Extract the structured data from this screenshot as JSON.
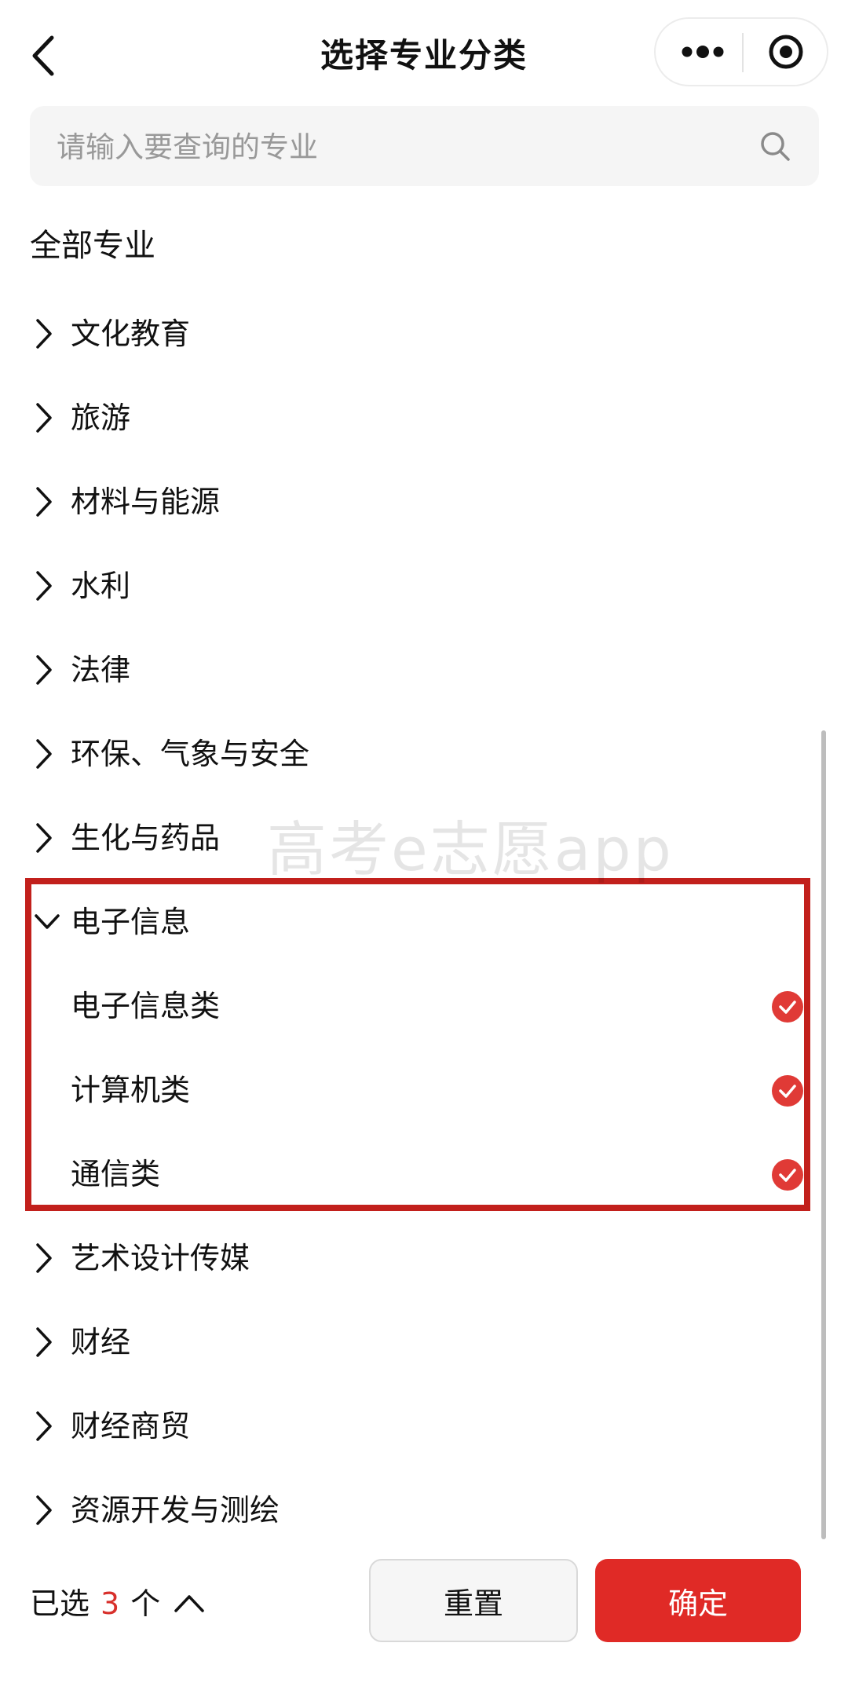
{
  "header": {
    "title": "选择专业分类",
    "icons": {
      "back": "back-arrow-icon",
      "more": "more-dots-icon",
      "close": "target-circle-icon"
    }
  },
  "search": {
    "placeholder": "请输入要查询的专业",
    "value": "",
    "icon": "search-icon"
  },
  "section_title": "全部专业",
  "categories": [
    {
      "label": "文化教育",
      "expanded": false
    },
    {
      "label": "旅游",
      "expanded": false
    },
    {
      "label": "材料与能源",
      "expanded": false
    },
    {
      "label": "水利",
      "expanded": false
    },
    {
      "label": "法律",
      "expanded": false
    },
    {
      "label": "环保、气象与安全",
      "expanded": false
    },
    {
      "label": "生化与药品",
      "expanded": false
    },
    {
      "label": "电子信息",
      "expanded": true,
      "children": [
        {
          "label": "电子信息类",
          "selected": true
        },
        {
          "label": "计算机类",
          "selected": true
        },
        {
          "label": "通信类",
          "selected": true
        }
      ]
    },
    {
      "label": "艺术设计传媒",
      "expanded": false
    },
    {
      "label": "财经",
      "expanded": false
    },
    {
      "label": "财经商贸",
      "expanded": false
    },
    {
      "label": "资源开发与测绘",
      "expanded": false
    }
  ],
  "watermark": "高考e志愿app",
  "footer": {
    "selected_prefix": "已选",
    "selected_count": "3",
    "selected_suffix": "个",
    "reset_label": "重置",
    "confirm_label": "确定"
  },
  "colors": {
    "accent": "#e02a26",
    "highlight_border": "#c2201c",
    "check": "#e03a36"
  }
}
